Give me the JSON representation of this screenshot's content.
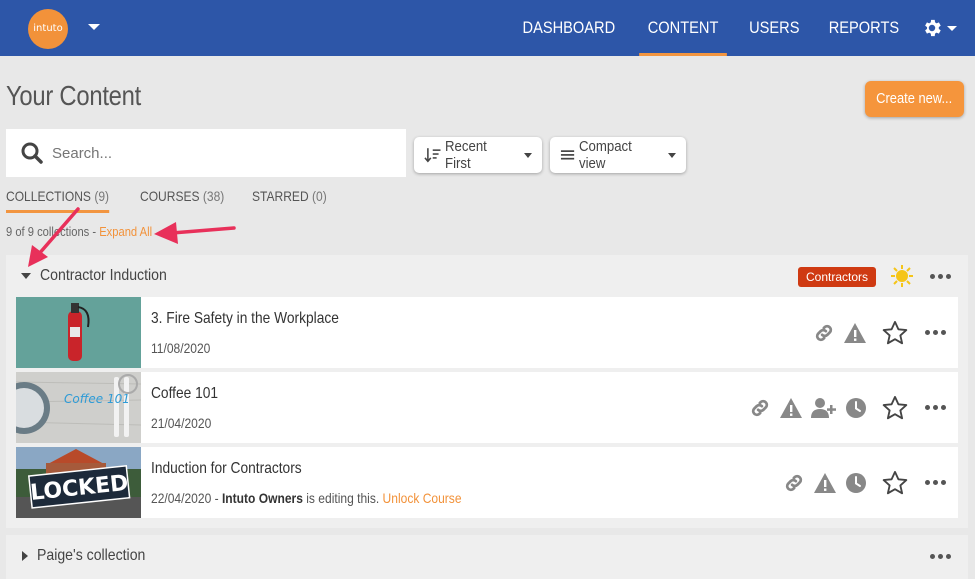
{
  "header": {
    "logo_text": "intuto",
    "nav": [
      "DASHBOARD",
      "CONTENT",
      "USERS",
      "REPORTS"
    ],
    "active_nav": "CONTENT",
    "brand_color": "#2d56a8",
    "accent_color": "#f29540"
  },
  "page": {
    "title": "Your Content",
    "create_button": "Create new..."
  },
  "search": {
    "placeholder": "Search..."
  },
  "sort": {
    "label": "Recent First"
  },
  "view": {
    "label": "Compact view"
  },
  "tabs": [
    {
      "label": "COLLECTIONS",
      "count": "(9)"
    },
    {
      "label": "COURSES",
      "count": "(38)"
    },
    {
      "label": "STARRED",
      "count": "(0)"
    }
  ],
  "summary": {
    "text": "9 of 9 collections - ",
    "link": "Expand All"
  },
  "collections": [
    {
      "name": "Contractor Induction",
      "badge": "Contractors",
      "courses": [
        {
          "title": "3. Fire Safety in the Workplace",
          "date": "11/08/2020",
          "icons": [
            "link-icon",
            "warning-icon",
            "star-icon",
            "more-icon"
          ]
        },
        {
          "title": "Coffee 101",
          "date": "21/04/2020",
          "thumb_text": "Coffee 101",
          "icons": [
            "link-icon",
            "warning-icon",
            "add-user-icon",
            "clock-icon",
            "star-icon",
            "more-icon"
          ]
        },
        {
          "title": "Induction for Contractors",
          "date": "22/04/2020 - ",
          "editor": "Intuto Owners",
          "editing_text": " is editing this. ",
          "unlock": "Unlock Course",
          "thumb_text": "LOCKED",
          "icons": [
            "link-icon",
            "warning-icon",
            "clock-icon",
            "star-icon",
            "more-icon"
          ]
        }
      ]
    },
    {
      "name": "Paige's collection"
    }
  ]
}
